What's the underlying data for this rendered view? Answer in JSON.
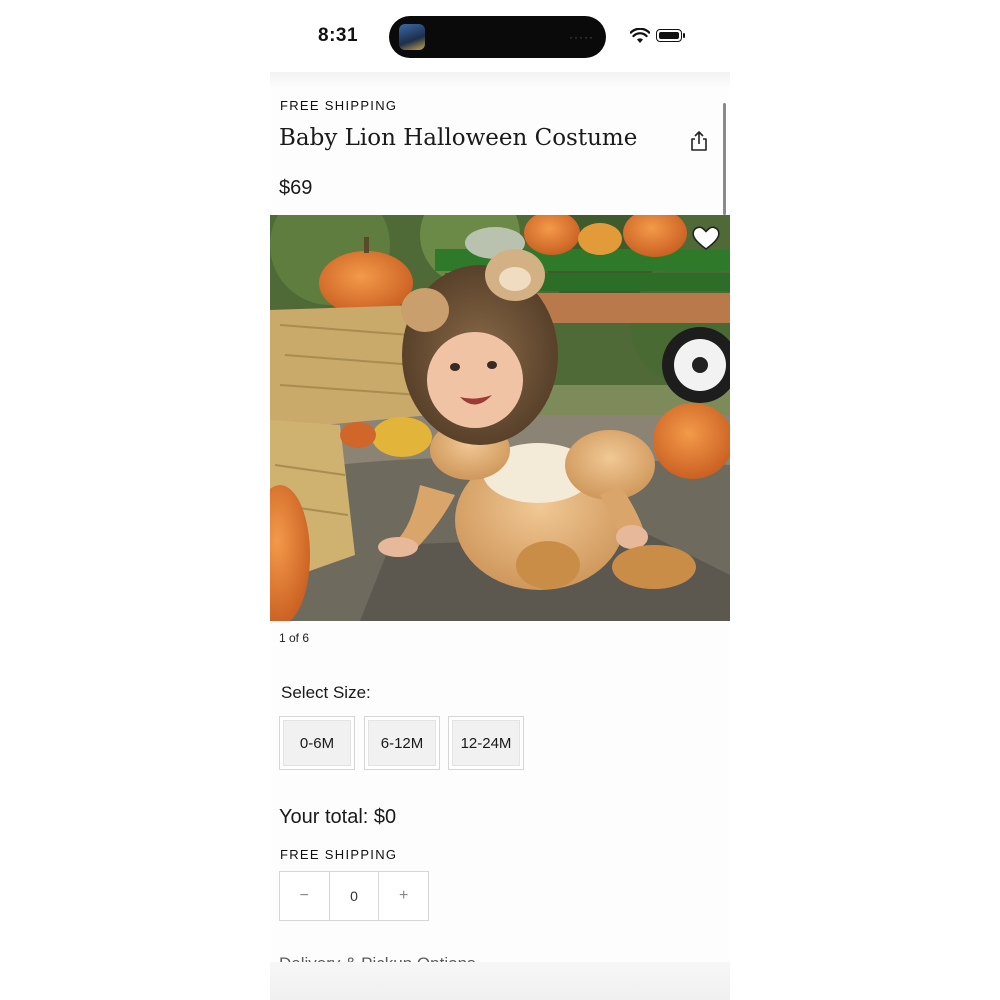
{
  "status_bar": {
    "time": "8:31"
  },
  "product": {
    "shipping_badge": "FREE SHIPPING",
    "title": "Baby Lion Halloween Costume",
    "price": "$69",
    "image_counter": "1 of 6"
  },
  "size_selector": {
    "label": "Select Size:",
    "options": [
      "0-6M",
      "6-12M",
      "12-24M"
    ]
  },
  "purchase": {
    "total": "Your total: $0",
    "shipping_badge": "FREE SHIPPING",
    "decrement": "−",
    "quantity": "0",
    "increment": "+"
  },
  "below_fold": {
    "partial_heading": "Delivery & Pickup Options"
  },
  "icons": [
    "wifi-icon",
    "battery-icon",
    "share-icon",
    "heart-icon"
  ]
}
